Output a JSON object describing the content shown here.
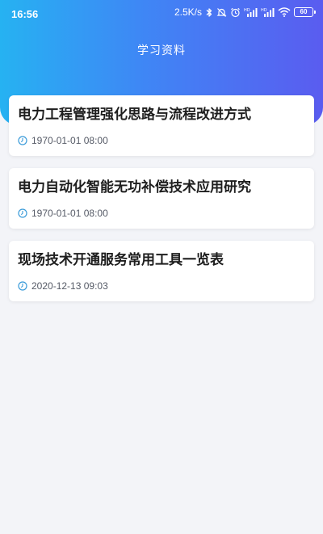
{
  "status_bar": {
    "time": "16:56",
    "network_speed": "2.5K/s",
    "battery_level": "60",
    "icons": [
      "bluetooth-icon",
      "mute-bell-icon",
      "alarm-icon",
      "hd-signal-icon-1",
      "hd-signal-icon-2",
      "wifi-icon",
      "battery-icon"
    ]
  },
  "header": {
    "title": "学习资料"
  },
  "items": [
    {
      "title": "电力工程管理强化思路与流程改进方式",
      "date": "1970-01-01 08:00"
    },
    {
      "title": "电力自动化智能无功补偿技术应用研究",
      "date": "1970-01-01 08:00"
    },
    {
      "title": "现场技术开通服务常用工具一览表",
      "date": "2020-12-13 09:03"
    }
  ],
  "colors": {
    "header_gradient": [
      "#26b2f2",
      "#3f86f5",
      "#5a5cf0"
    ],
    "background": "#f3f4f8",
    "clock_icon": "#3a9bd9"
  }
}
